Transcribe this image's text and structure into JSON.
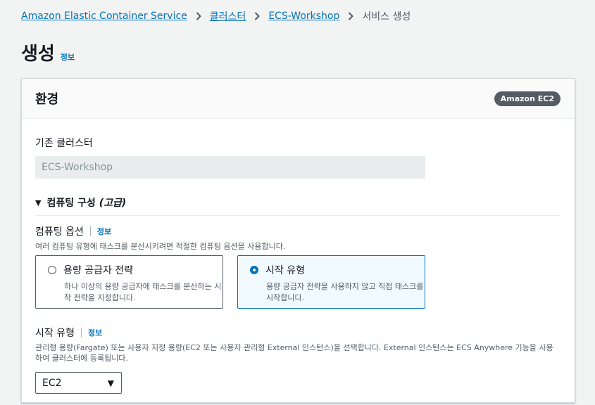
{
  "breadcrumb": {
    "items": [
      "Amazon Elastic Container Service",
      "클러스터",
      "ECS-Workshop"
    ],
    "current": "서비스 생성"
  },
  "page": {
    "title": "생성",
    "info": "정보"
  },
  "panel": {
    "title": "환경",
    "badge": "Amazon EC2",
    "existing_cluster": {
      "label": "기존 클러스터",
      "value": "ECS-Workshop"
    },
    "compute_config": {
      "label": "컴퓨팅 구성",
      "suffix": "(고급)"
    },
    "compute_options": {
      "label": "컴퓨팅 옵션",
      "info": "정보",
      "description": "여러 컴퓨팅 유형에 태스크를 분산시키려면 적절한 컴퓨팅 옵션을 사용합니다.",
      "tiles": [
        {
          "title": "용량 공급자 전략",
          "desc": "하나 이상의 용량 공급자에 태스크를 분산하는 시작 전략을 지정합니다.",
          "selected": false
        },
        {
          "title": "시작 유형",
          "desc": "용량 공급자 전략을 사용하지 않고 직접 태스크를 시작합니다.",
          "selected": true
        }
      ]
    },
    "launch_type": {
      "label": "시작 유형",
      "info": "정보",
      "description": "관리형 용량(Fargate) 또는 사용자 지정 용량(EC2 또는 사용자 관리형 External 인스턴스)을 선택합니다. External 인스턴스는 ECS Anywhere 기능을 사용하여 클러스터에 등록됩니다.",
      "selected": "EC2"
    }
  },
  "colors": {
    "link": "#0073bb",
    "badge_bg": "#545b64",
    "selected_tile_bg": "#f1faff"
  },
  "icons": {
    "separator": "chevron-right-icon",
    "caret": "caret-down-icon",
    "select": "select-arrow-icon"
  }
}
